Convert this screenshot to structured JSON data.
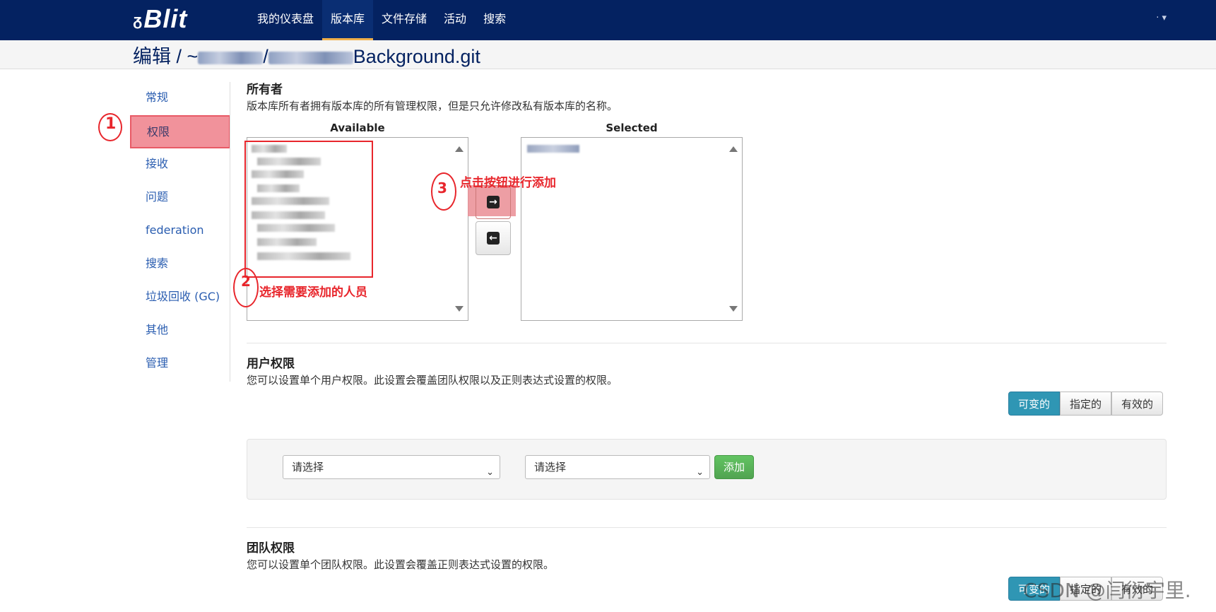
{
  "header": {
    "logo_text": "Blit",
    "logo_glyph": "ᵹ",
    "nav": [
      {
        "label": "我的仪表盘"
      },
      {
        "label": "版本库"
      },
      {
        "label": "文件存储"
      },
      {
        "label": "活动"
      },
      {
        "label": "搜索"
      }
    ],
    "user_menu": "· ▾"
  },
  "page": {
    "title_prefix": "编辑 / ~",
    "title_sep": "/",
    "title_suffix": "Background.git"
  },
  "sidebar": {
    "items": [
      {
        "label": "常规"
      },
      {
        "label": "权限"
      },
      {
        "label": "接收"
      },
      {
        "label": "问题"
      },
      {
        "label": "federation"
      },
      {
        "label": "搜索"
      },
      {
        "label": "垃圾回收 (GC)"
      },
      {
        "label": "其他"
      },
      {
        "label": "管理"
      }
    ]
  },
  "owner": {
    "heading": "所有者",
    "help": "版本库所有者拥有版本库的所有管理权限，但是只允许修改私有版本库的名称。",
    "available_label": "Available",
    "selected_label": "Selected",
    "move_right_icon": "→",
    "move_left_icon": "←"
  },
  "annotations": {
    "step1": "1",
    "step2": "2",
    "step2_text": "选择需要添加的人员",
    "step3": "3",
    "step3_text": "点击按钮进行添加"
  },
  "user_perms": {
    "heading": "用户权限",
    "help": "您可以设置单个用户权限。此设置会覆盖团队权限以及正则表达式设置的权限。",
    "filters": [
      "可变的",
      "指定的",
      "有效的"
    ],
    "select1": "请选择",
    "select2": "请选择",
    "add_label": "添加"
  },
  "team_perms": {
    "heading": "团队权限",
    "help": "您可以设置单个团队权限。此设置会覆盖正则表达式设置的权限。",
    "filters": [
      "可变的",
      "指定的",
      "有效的"
    ]
  },
  "watermark": "CSDN @闫衍宇里.",
  "colors": {
    "topbar": "#042261",
    "link": "#2a5db0",
    "annotation": "#e8262c",
    "highlight": "#f1929b",
    "filter_active": "#2f96b4",
    "add_button": "#5bb75b"
  }
}
